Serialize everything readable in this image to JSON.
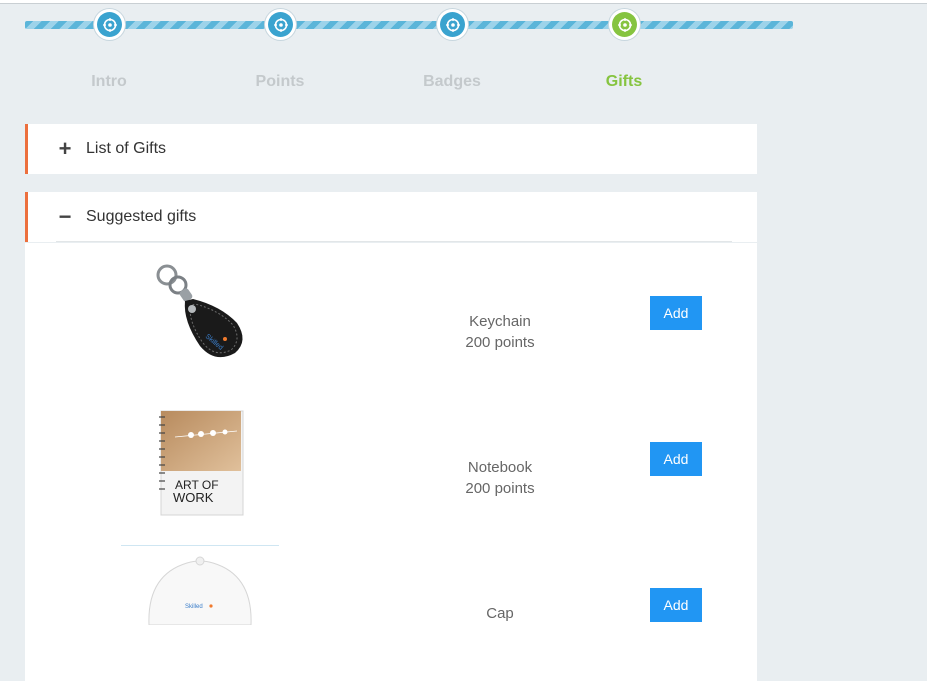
{
  "wizard": {
    "steps": [
      {
        "label": "Intro",
        "state": "done"
      },
      {
        "label": "Points",
        "state": "done"
      },
      {
        "label": "Badges",
        "state": "done"
      },
      {
        "label": "Gifts",
        "state": "active"
      }
    ]
  },
  "list_of_gifts": {
    "title": "List of Gifts",
    "toggle": "+",
    "expanded": false
  },
  "suggested_gifts": {
    "title": "Suggested gifts",
    "toggle": "−",
    "expanded": true,
    "items": [
      {
        "name": "Keychain",
        "points": "200 points",
        "add_label": "Add",
        "image": "keychain-image"
      },
      {
        "name": "Notebook",
        "points": "200 points",
        "add_label": "Add",
        "image": "notebook-image"
      },
      {
        "name": "Cap",
        "points": "",
        "add_label": "Add",
        "image": "cap-image"
      }
    ]
  },
  "colors": {
    "progress": "#5bb5d9",
    "step_done": "#3aa3cf",
    "step_active": "#86c440",
    "panel_accent": "#ec6f3d",
    "add_button": "#2196f3"
  }
}
